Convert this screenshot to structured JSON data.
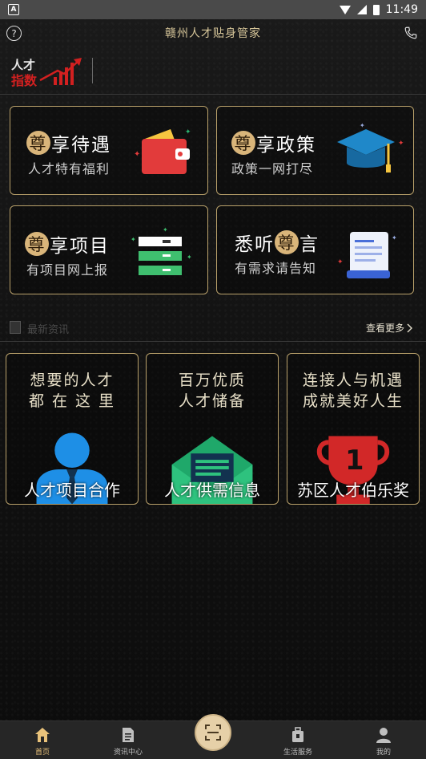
{
  "status_bar": {
    "time": "11:49",
    "left_icon": "A"
  },
  "header": {
    "title": "赣州人才贴身管家",
    "help_icon": "help-circle-icon",
    "phone_icon": "phone-icon"
  },
  "logo": {
    "line1": "人才",
    "line2": "指数"
  },
  "cards": [
    {
      "zun_first": "尊",
      "title_rest": "享待遇",
      "subtitle": "人才特有福利",
      "icon": "wallet-icon"
    },
    {
      "zun_first": "尊",
      "title_rest": "享政策",
      "subtitle": "政策一网打尽",
      "icon": "graduation-cap-icon"
    },
    {
      "zun_first": "尊",
      "title_rest": "享项目",
      "subtitle": "有项目网上报",
      "icon": "server-stack-icon"
    },
    {
      "title_pre": "悉听",
      "zun_mid": "尊",
      "title_post": "言",
      "subtitle": "有需求请告知",
      "icon": "document-scroll-icon"
    }
  ],
  "news": {
    "label": "最新资讯",
    "more": "查看更多"
  },
  "big_cards": [
    {
      "line1": "想要的人才",
      "line2": "都 在 这 里",
      "caption": "人才项目合作",
      "icon": "person-icon"
    },
    {
      "line1": "百万优质",
      "line2": "人才储备",
      "caption": "人才供需信息",
      "icon": "envelope-icon"
    },
    {
      "line1": "连接人与机遇",
      "line2": "成就美好人生",
      "caption": "苏区人才伯乐奖",
      "icon": "trophy-icon"
    }
  ],
  "bottom_nav": [
    {
      "label": "首页",
      "icon": "home-icon",
      "active": true
    },
    {
      "label": "资讯中心",
      "icon": "document-icon",
      "active": false
    },
    {
      "label": "生活服务",
      "icon": "briefcase-icon",
      "active": false
    },
    {
      "label": "我的",
      "icon": "user-icon",
      "active": false
    }
  ],
  "center_button": {
    "icon": "scan-icon"
  },
  "colors": {
    "gold": "#b8a06a",
    "accent": "#e9c27a",
    "zun_badge": "#d9b57a",
    "background": "#141414"
  }
}
